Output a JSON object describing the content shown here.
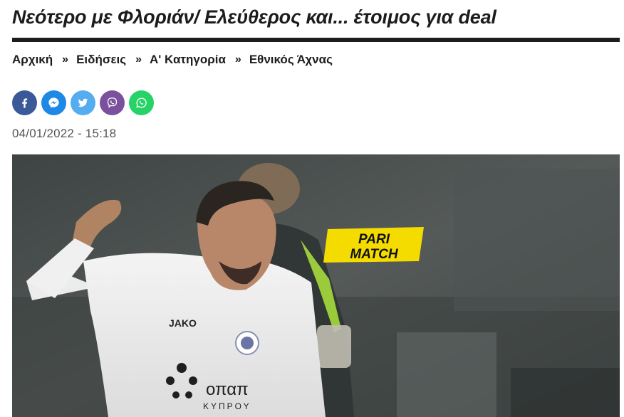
{
  "article": {
    "title": "Νεότερο με Φλοριάν/ Ελεύθερος και... έτοιμος για deal",
    "date": "04/01/2022 - 15:18"
  },
  "breadcrumb": {
    "items": [
      "Αρχική",
      "Ειδήσεις",
      "Α' Κατηγορία",
      "Εθνικός Άχνας"
    ],
    "separator": "»"
  },
  "share": [
    {
      "name": "facebook",
      "icon": "facebook-icon",
      "color": "#3b5998"
    },
    {
      "name": "messenger",
      "icon": "messenger-icon",
      "color": "#1e88e5"
    },
    {
      "name": "twitter",
      "icon": "twitter-icon",
      "color": "#55acee"
    },
    {
      "name": "viber",
      "icon": "viber-icon",
      "color": "#7b519d"
    },
    {
      "name": "whatsapp",
      "icon": "whatsapp-icon",
      "color": "#25d366"
    }
  ],
  "photo": {
    "sponsor_logo_line1": "PARI",
    "sponsor_logo_line2": "MATCH",
    "jersey_brand": "JAKO",
    "jersey_sponsor": "οπαπ",
    "jersey_sponsor_sub": "ΚΥΠΡΟΥ"
  }
}
